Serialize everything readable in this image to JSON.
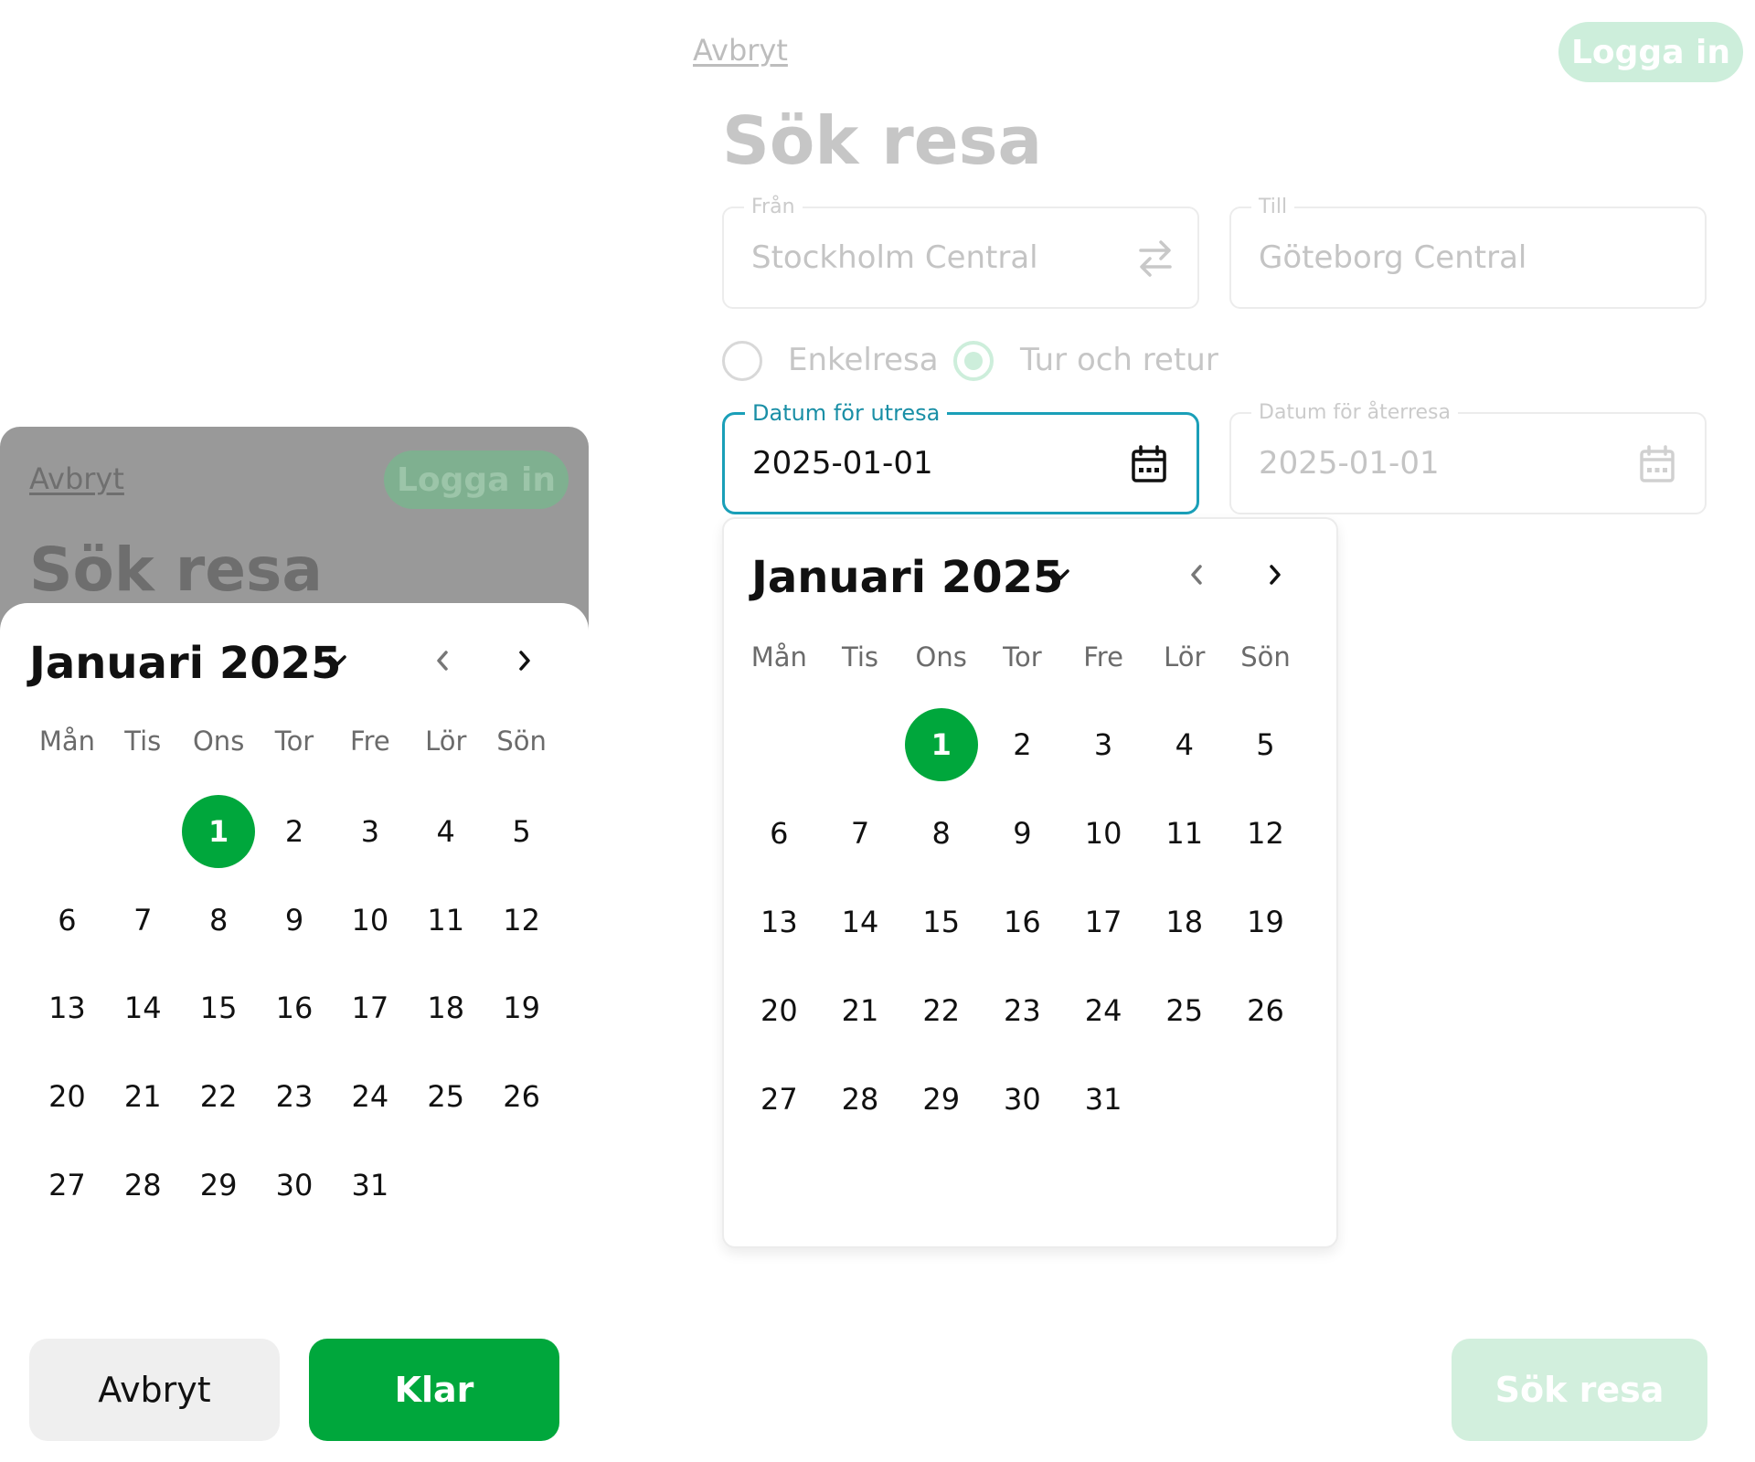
{
  "desktop": {
    "cancel_link": "Avbryt",
    "login_button": "Logga in",
    "title": "Sök resa",
    "from": {
      "label": "Från",
      "value": "Stockholm Central",
      "icon": "swap-arrows-icon"
    },
    "to": {
      "label": "Till",
      "value": "Göteborg Central"
    },
    "trip_types": [
      {
        "label": "Enkelresa",
        "selected": false
      },
      {
        "label": "Tur och retur",
        "selected": true
      }
    ],
    "outbound_date": {
      "label": "Datum för utresa",
      "value": "2025-01-01",
      "icon": "calendar-icon"
    },
    "return_date": {
      "label": "Datum för återresa",
      "value": "2025-01-01",
      "icon": "calendar-icon"
    },
    "search_button": "Sök resa"
  },
  "calendar": {
    "month_label": "Januari 2025",
    "weekdays": [
      "Mån",
      "Tis",
      "Ons",
      "Tor",
      "Fre",
      "Lör",
      "Sön"
    ],
    "leading_blanks": 2,
    "days": [
      "1",
      "2",
      "3",
      "4",
      "5",
      "6",
      "7",
      "8",
      "9",
      "10",
      "11",
      "12",
      "13",
      "14",
      "15",
      "16",
      "17",
      "18",
      "19",
      "20",
      "21",
      "22",
      "23",
      "24",
      "25",
      "26",
      "27",
      "28",
      "29",
      "30",
      "31"
    ],
    "selected_day": "1"
  },
  "mobile": {
    "cancel_link": "Avbryt",
    "login_button": "Logga in",
    "title": "Sök resa",
    "cancel_button": "Avbryt",
    "done_button": "Klar"
  },
  "colors": {
    "brand_green": "#00a73c",
    "focus_teal": "#1a9fb8",
    "faded_green": "#cdeedb"
  }
}
